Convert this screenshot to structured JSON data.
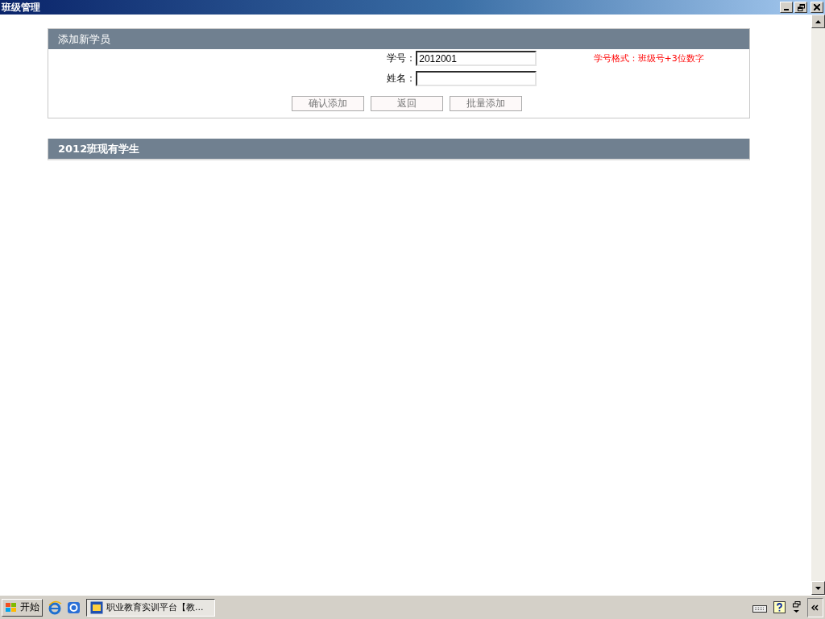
{
  "window": {
    "title": "班级管理"
  },
  "add_panel": {
    "title": "添加新学员",
    "fields": [
      {
        "label": "学号：",
        "value": "2012001",
        "hint": "学号格式：班级号+3位数字"
      },
      {
        "label": "姓名："
      }
    ],
    "buttons": [
      "确认添加",
      "返回",
      "批量添加"
    ]
  },
  "list_panel": {
    "title": "2012班现有学生"
  },
  "taskbar": {
    "start": "开始",
    "tasks": [
      {
        "label": "职业教育实训平台【教...",
        "selected": true
      }
    ]
  }
}
